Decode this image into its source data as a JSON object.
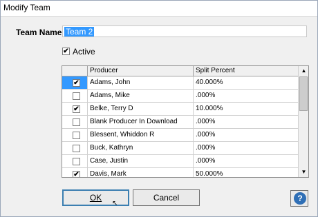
{
  "window": {
    "title": "Modify Team"
  },
  "team_name": {
    "label": "Team Name:",
    "value": "Team 2"
  },
  "active": {
    "label": "Active",
    "checked": true
  },
  "grid": {
    "columns": [
      "",
      "Producer",
      "Split Percent"
    ],
    "rows": [
      {
        "checked": true,
        "producer": "Adams, John",
        "split": "40.000%",
        "selected": true
      },
      {
        "checked": false,
        "producer": "Adams, Mike",
        "split": ".000%"
      },
      {
        "checked": true,
        "producer": "Belke, Terry D",
        "split": "10.000%"
      },
      {
        "checked": false,
        "producer": "Blank Producer In Download",
        "split": ".000%"
      },
      {
        "checked": false,
        "producer": "Blessent, Whiddon R",
        "split": ".000%"
      },
      {
        "checked": false,
        "producer": "Buck, Kathryn",
        "split": ".000%"
      },
      {
        "checked": false,
        "producer": "Case, Justin",
        "split": ".000%"
      },
      {
        "checked": true,
        "producer": "Davis, Mark",
        "split": "50.000%"
      }
    ]
  },
  "buttons": {
    "ok": "OK",
    "cancel": "Cancel",
    "help": "?"
  },
  "icons": {
    "check": "✔",
    "scroll_up": "▲",
    "scroll_down": "▼",
    "cursor": "↖"
  }
}
